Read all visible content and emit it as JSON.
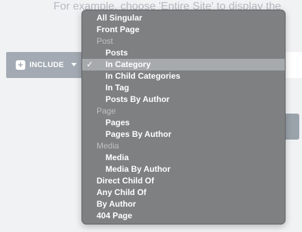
{
  "hint": {
    "text": "For example, choose 'Entire Site' to display the"
  },
  "include_button": {
    "label": "INCLUDE",
    "icon": "plus-icon",
    "caret_icon": "caret-down-icon"
  },
  "menu": {
    "items": [
      {
        "label": "All Singular",
        "type": "option",
        "level": 0,
        "selected": false
      },
      {
        "label": "Front Page",
        "type": "option",
        "level": 0,
        "selected": false
      },
      {
        "label": "Post",
        "type": "group",
        "level": 0,
        "selected": false
      },
      {
        "label": "Posts",
        "type": "option",
        "level": 1,
        "selected": false
      },
      {
        "label": "In Category",
        "type": "option",
        "level": 1,
        "selected": true
      },
      {
        "label": "In Child Categories",
        "type": "option",
        "level": 1,
        "selected": false
      },
      {
        "label": "In Tag",
        "type": "option",
        "level": 1,
        "selected": false
      },
      {
        "label": "Posts By Author",
        "type": "option",
        "level": 1,
        "selected": false
      },
      {
        "label": "Page",
        "type": "group",
        "level": 0,
        "selected": false
      },
      {
        "label": "Pages",
        "type": "option",
        "level": 1,
        "selected": false
      },
      {
        "label": "Pages By Author",
        "type": "option",
        "level": 1,
        "selected": false
      },
      {
        "label": "Media",
        "type": "group",
        "level": 0,
        "selected": false
      },
      {
        "label": "Media",
        "type": "option",
        "level": 1,
        "selected": false
      },
      {
        "label": "Media By Author",
        "type": "option",
        "level": 1,
        "selected": false
      },
      {
        "label": "Direct Child Of",
        "type": "option",
        "level": 0,
        "selected": false
      },
      {
        "label": "Any Child Of",
        "type": "option",
        "level": 0,
        "selected": false
      },
      {
        "label": "By Author",
        "type": "option",
        "level": 0,
        "selected": false
      },
      {
        "label": "404 Page",
        "type": "option",
        "level": 0,
        "selected": false
      }
    ],
    "check_glyph": "✓"
  },
  "colors": {
    "menu_bg": "#7e8082",
    "selected_bg": "#a7aaad",
    "button_bg": "#a3aab3"
  }
}
